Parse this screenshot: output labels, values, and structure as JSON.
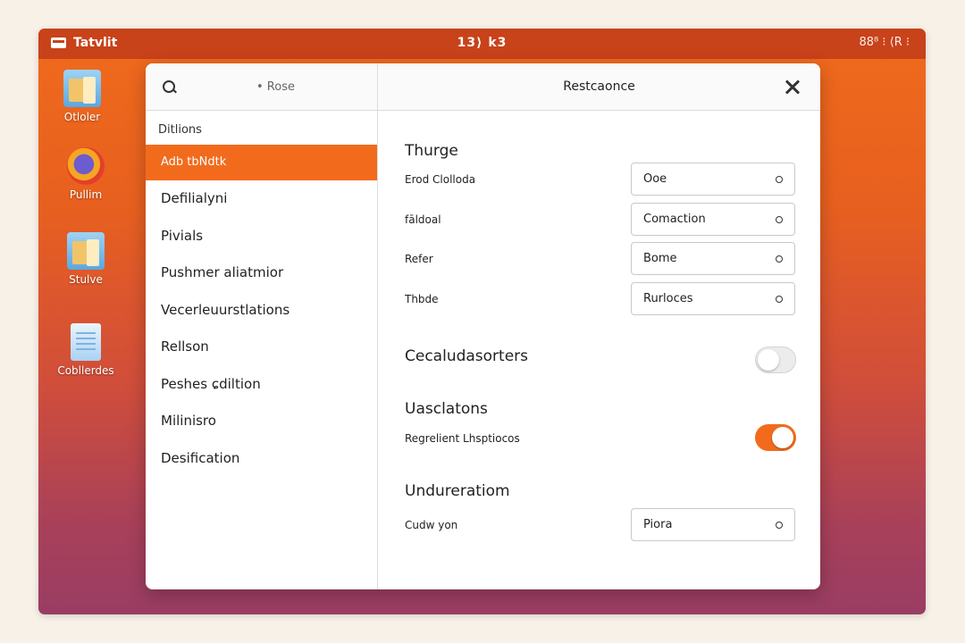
{
  "topbar": {
    "app_name": "Tatvlit",
    "clock": "13⟩ k3",
    "tray": "88⁸ ⁝ ⟨R ⁝"
  },
  "desktop": {
    "icons": [
      {
        "label": "Otloler",
        "icon": "folder-icon"
      },
      {
        "label": "Pullim",
        "icon": "browser-icon"
      },
      {
        "label": "Stulve",
        "icon": "folder-icon"
      },
      {
        "label": "Cobllerdes",
        "icon": "document-icon"
      }
    ]
  },
  "dialog": {
    "search": {
      "placeholder": "• Rose"
    },
    "sidebar_header": "Ditlions",
    "nav_items": [
      {
        "label": "Adb tbNdtk",
        "active": true
      },
      {
        "label": "Defilialyni",
        "active": false
      },
      {
        "label": "Pivials",
        "active": false
      },
      {
        "label": "Pushmer aliatmior",
        "active": false
      },
      {
        "label": "Vecerleuurstlations",
        "active": false
      },
      {
        "label": "Rellson",
        "active": false
      },
      {
        "label": "Peshes ɕdiltion",
        "active": false
      },
      {
        "label": "Milinisro",
        "active": false
      },
      {
        "label": "Desification",
        "active": false
      }
    ],
    "title": "Restcaonce",
    "sections": {
      "s1_title": "Thurge",
      "rows": [
        {
          "label": "Erod Clolloda",
          "value": "Ooe"
        },
        {
          "label": "fāldoal",
          "value": "Comaction"
        },
        {
          "label": "Refer",
          "value": "Bome"
        },
        {
          "label": "Thbde",
          "value": "Rurloces"
        }
      ],
      "s2_title": "Cecaludasorters",
      "s2_toggle_on": false,
      "s3_title": "Uasclatons",
      "s3_row_label": "Regrelient Lhsptiocos",
      "s3_toggle_on": true,
      "s4_title": "Undureratiom",
      "s4_row_label": "Cudw yon",
      "s4_value": "Piora"
    }
  },
  "colors": {
    "accent": "#f26b1d",
    "topbar": "#c8421a",
    "desktop_top": "#f06a1c",
    "desktop_bottom": "#9a3d63"
  }
}
